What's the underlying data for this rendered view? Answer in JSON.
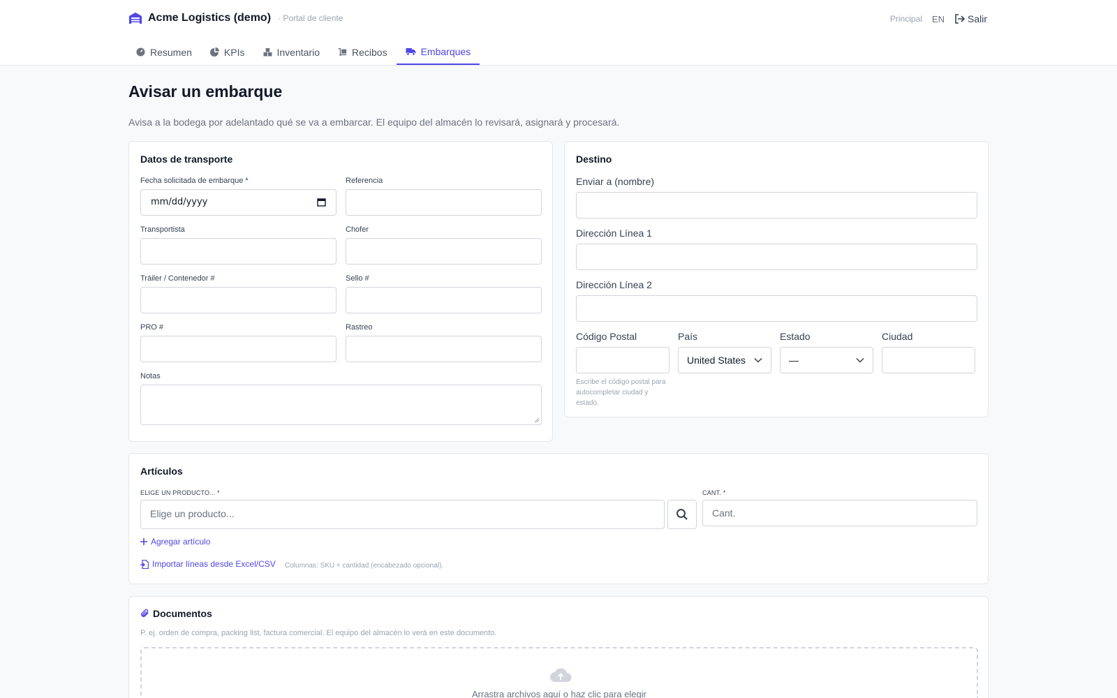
{
  "header": {
    "brand_name": "Acme Logistics (demo)",
    "brand_sub": "· Portal de cliente",
    "link_principal": "Principal",
    "lang": "EN",
    "logout": "Salir",
    "accent": "#4f46e5"
  },
  "nav": {
    "tabs": [
      {
        "label": "Resumen",
        "icon": "dashboard-icon"
      },
      {
        "label": "KPIs",
        "icon": "pie-chart-icon"
      },
      {
        "label": "Inventario",
        "icon": "boxes-icon"
      },
      {
        "label": "Recibos",
        "icon": "dolly-icon"
      },
      {
        "label": "Embarques",
        "icon": "truck-icon",
        "active": true
      }
    ]
  },
  "page": {
    "title": "Avisar un embarque",
    "description": "Avisa a la bodega por adelantado qué se va a embarcar. El equipo del almacén lo revisará, asignará y procesará."
  },
  "transport": {
    "title": "Datos de transporte",
    "date_label": "Fecha solicitada de embarque *",
    "date_value": "mm/dd/yyyy",
    "reference_label": "Referencia",
    "carrier_label": "Transportista",
    "driver_label": "Chofer",
    "trailer_label": "Tráiler / Contenedor #",
    "seal_label": "Sello #",
    "pro_label": "PRO #",
    "tracking_label": "Rastreo",
    "notes_label": "Notas"
  },
  "destination": {
    "title": "Destino",
    "ship_to_label": "Enviar a (nombre)",
    "address1_label": "Dirección Línea 1",
    "address2_label": "Dirección Línea 2",
    "zip_label": "Código Postal",
    "zip_hint": "Escribe el código postal para autocompletar ciudad y estado.",
    "country_label": "País",
    "country_value": "United States",
    "state_label": "Estado",
    "state_value": "—",
    "city_label": "Ciudad"
  },
  "items": {
    "title": "Artículos",
    "product_label": "ELIGE UN PRODUCTO... *",
    "product_placeholder": "Elige un producto...",
    "qty_label": "CANT. *",
    "qty_placeholder": "Cant.",
    "add_item": "Agregar artículo",
    "import_link": "Importar líneas desde Excel/CSV",
    "import_note": "Columnas: SKU + cantidad (encabezado opcional)."
  },
  "documents": {
    "title": "Documentos",
    "description": "P. ej. orden de compra, packing list, factura comercial. El equipo del almacén lo verá en este documento.",
    "drop_text": "Arrastra archivos aquí o haz clic para elegir"
  }
}
